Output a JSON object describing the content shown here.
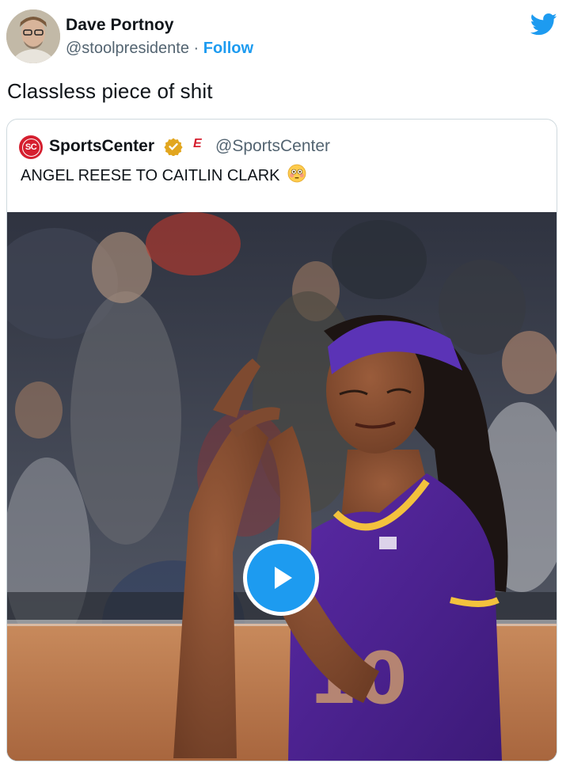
{
  "author": {
    "name": "Dave Portnoy",
    "handle": "@stoolpresidente",
    "separator": "·",
    "follow_label": "Follow",
    "avatar_icon": "avatar"
  },
  "tweet": {
    "text": "Classless piece of shit"
  },
  "quoted": {
    "name": "SportsCenter",
    "logo_text": "SC",
    "espn_mark": "E",
    "handle": "@SportsCenter",
    "text": "ANGEL REESE TO CAITLIN CLARK",
    "emoji_icon": "flushed-face-emoji"
  },
  "media": {
    "type": "video",
    "play_icon": "play-icon"
  },
  "colors": {
    "accent": "#1d9bf0",
    "text": "#0f1419",
    "muted": "#536471",
    "espn_red": "#d51f2f",
    "verified_gold": "#e2a61f"
  }
}
